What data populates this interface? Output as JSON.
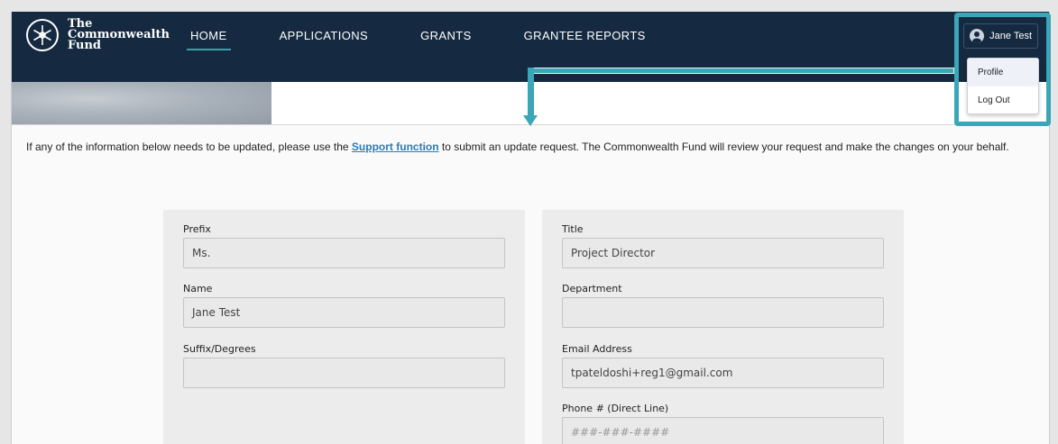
{
  "brand": {
    "line1": "The",
    "line2": "Commonwealth",
    "line3": "Fund",
    "icon": "snowflake-logo-icon"
  },
  "nav": [
    {
      "label": "HOME",
      "active": true
    },
    {
      "label": "APPLICATIONS",
      "active": false
    },
    {
      "label": "GRANTS",
      "active": false
    },
    {
      "label": "GRANTEE REPORTS",
      "active": false
    }
  ],
  "user": {
    "name": "Jane Test",
    "icon": "user-avatar-icon"
  },
  "user_menu": [
    {
      "label": "Profile"
    },
    {
      "label": "Log Out"
    }
  ],
  "notice": {
    "before": "If any of the information below needs to be updated, please use the ",
    "link": "Support function",
    "after": " to submit an update request. The Commonwealth Fund will review your request and make the changes on your behalf."
  },
  "form": {
    "left": [
      {
        "label": "Prefix",
        "value": "Ms."
      },
      {
        "label": "Name",
        "value": "Jane Test"
      },
      {
        "label": "Suffix/Degrees",
        "value": ""
      }
    ],
    "right": [
      {
        "label": "Title",
        "value": "Project Director"
      },
      {
        "label": "Department",
        "value": ""
      },
      {
        "label": "Email Address",
        "value": "tpateldoshi+reg1@gmail.com"
      },
      {
        "label": "Phone # (Direct Line)",
        "placeholder": "###-###-####"
      }
    ]
  },
  "colors": {
    "nav_bg": "#152a40",
    "accent": "#3aa6b8",
    "link": "#2c7bb6"
  }
}
